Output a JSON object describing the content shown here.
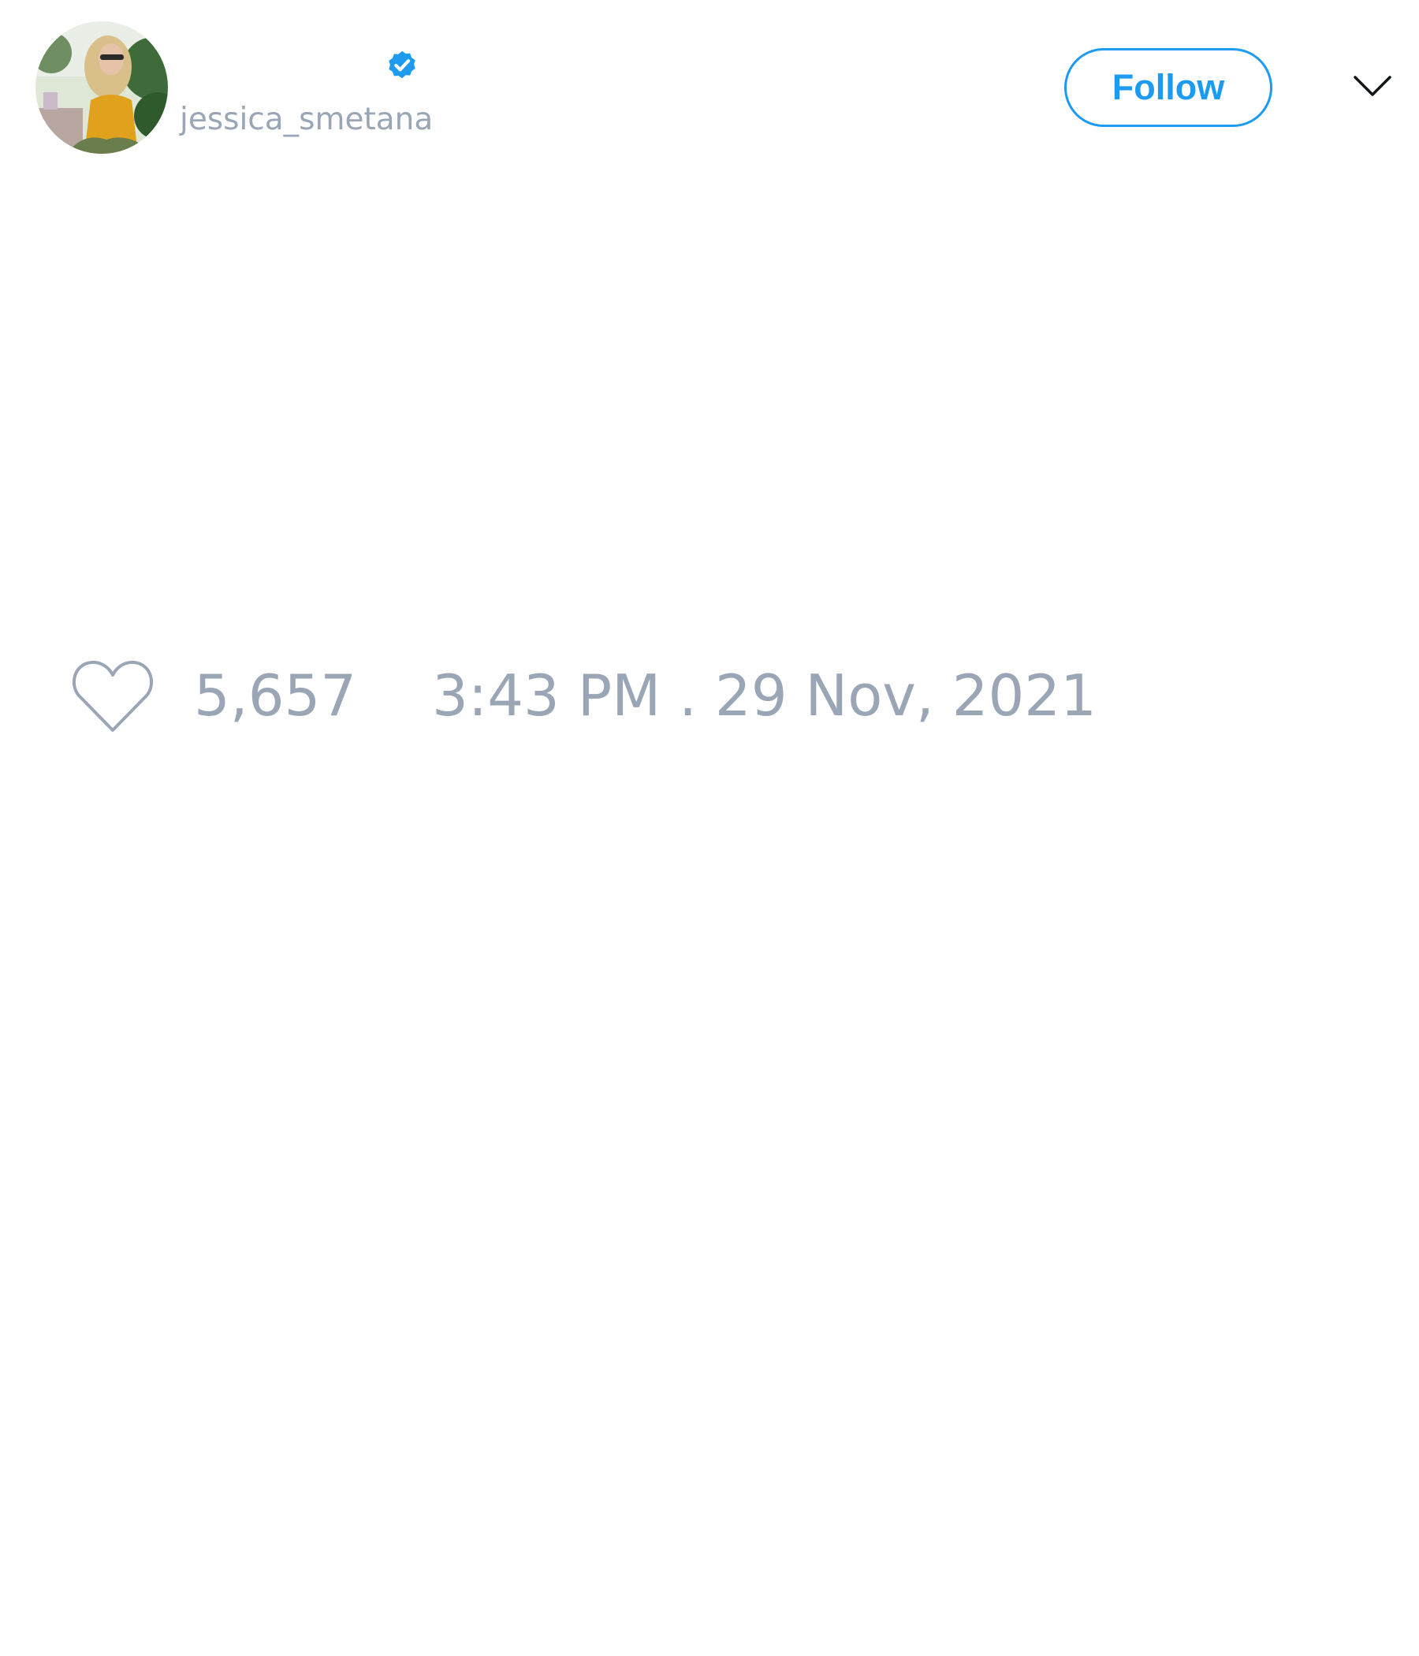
{
  "profile": {
    "display_name": "",
    "handle": "jessica_smetana",
    "verified": true,
    "avatar_icon": "profile-photo"
  },
  "actions": {
    "follow_label": "Follow",
    "menu_icon": "chevron-down-icon"
  },
  "tweet": {
    "text": "",
    "like_icon": "heart-outline-icon",
    "like_count": "5,657",
    "timestamp": "3:43 PM . 29 Nov, 2021"
  },
  "colors": {
    "accent": "#1d9bf0",
    "muted_text": "#9aa6b5",
    "background": "#ffffff"
  }
}
